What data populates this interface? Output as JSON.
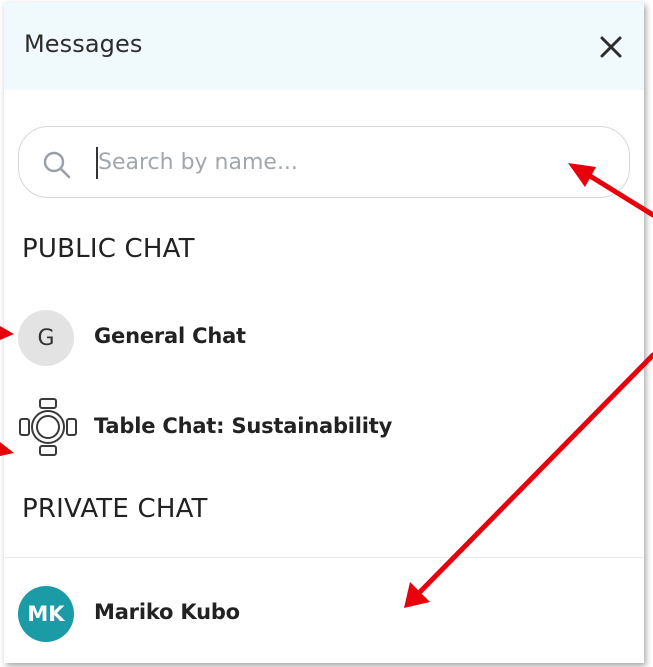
{
  "header": {
    "title": "Messages",
    "close_icon": "close-icon"
  },
  "search": {
    "placeholder": "Search by name...",
    "value": "",
    "icon": "search-icon"
  },
  "public_chat": {
    "title": "PUBLIC CHAT",
    "items": [
      {
        "label": "General Chat",
        "avatar_text": "G",
        "avatar_color": "#e3e3e3"
      },
      {
        "label": "Table Chat: Sustainability",
        "icon": "table-icon"
      }
    ]
  },
  "private_chat": {
    "title": "PRIVATE CHAT",
    "items": [
      {
        "label": "Mariko Kubo",
        "avatar_text": "MK",
        "avatar_color": "#1a9ba6"
      }
    ]
  },
  "colors": {
    "header_bg": "#f0f9fc",
    "accent": "#1a9ba6",
    "annotation_arrow": "#e8000b"
  }
}
